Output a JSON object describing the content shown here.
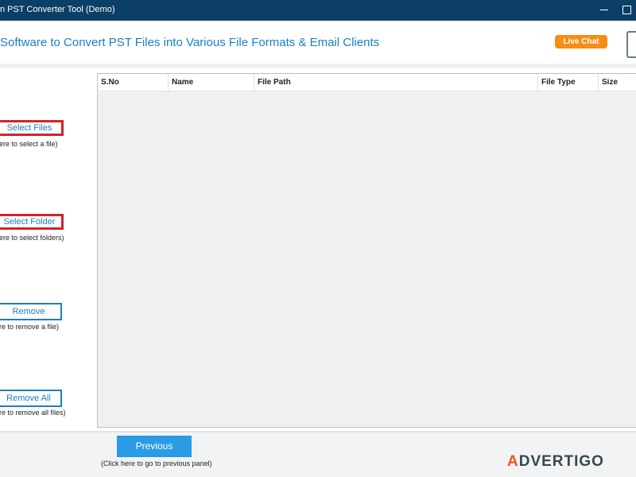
{
  "window": {
    "title": "n PST Converter Tool (Demo)"
  },
  "header": {
    "headline": "Software to Convert PST Files into Various File Formats & Email Clients",
    "live_chat_label": "Live Chat"
  },
  "left_panel": {
    "select_files": {
      "label": "Select Files",
      "hint": "here to select a file)"
    },
    "select_folder": {
      "label": "Select Folder",
      "hint": "here to select folders)"
    },
    "remove": {
      "label": "Remove",
      "hint": "ere to remove a file)"
    },
    "remove_all": {
      "label": "Remove All",
      "hint": "ere to remove all files)"
    }
  },
  "table": {
    "columns": [
      "S.No",
      "Name",
      "File Path",
      "File Type",
      "Size"
    ],
    "rows": []
  },
  "footer": {
    "previous_label": "Previous",
    "previous_hint": "(Click here to go to previous panel)"
  },
  "watermark": {
    "mark": "A",
    "text": "DVERTIGO"
  },
  "colors": {
    "titlebar": "#0b3f66",
    "accent_blue": "#1d7fc0",
    "live_chat": "#f68d16",
    "select_border": "#d2232a",
    "previous_button": "#2a9be6"
  },
  "icons": [
    "minimize-icon",
    "maximize-icon"
  ]
}
